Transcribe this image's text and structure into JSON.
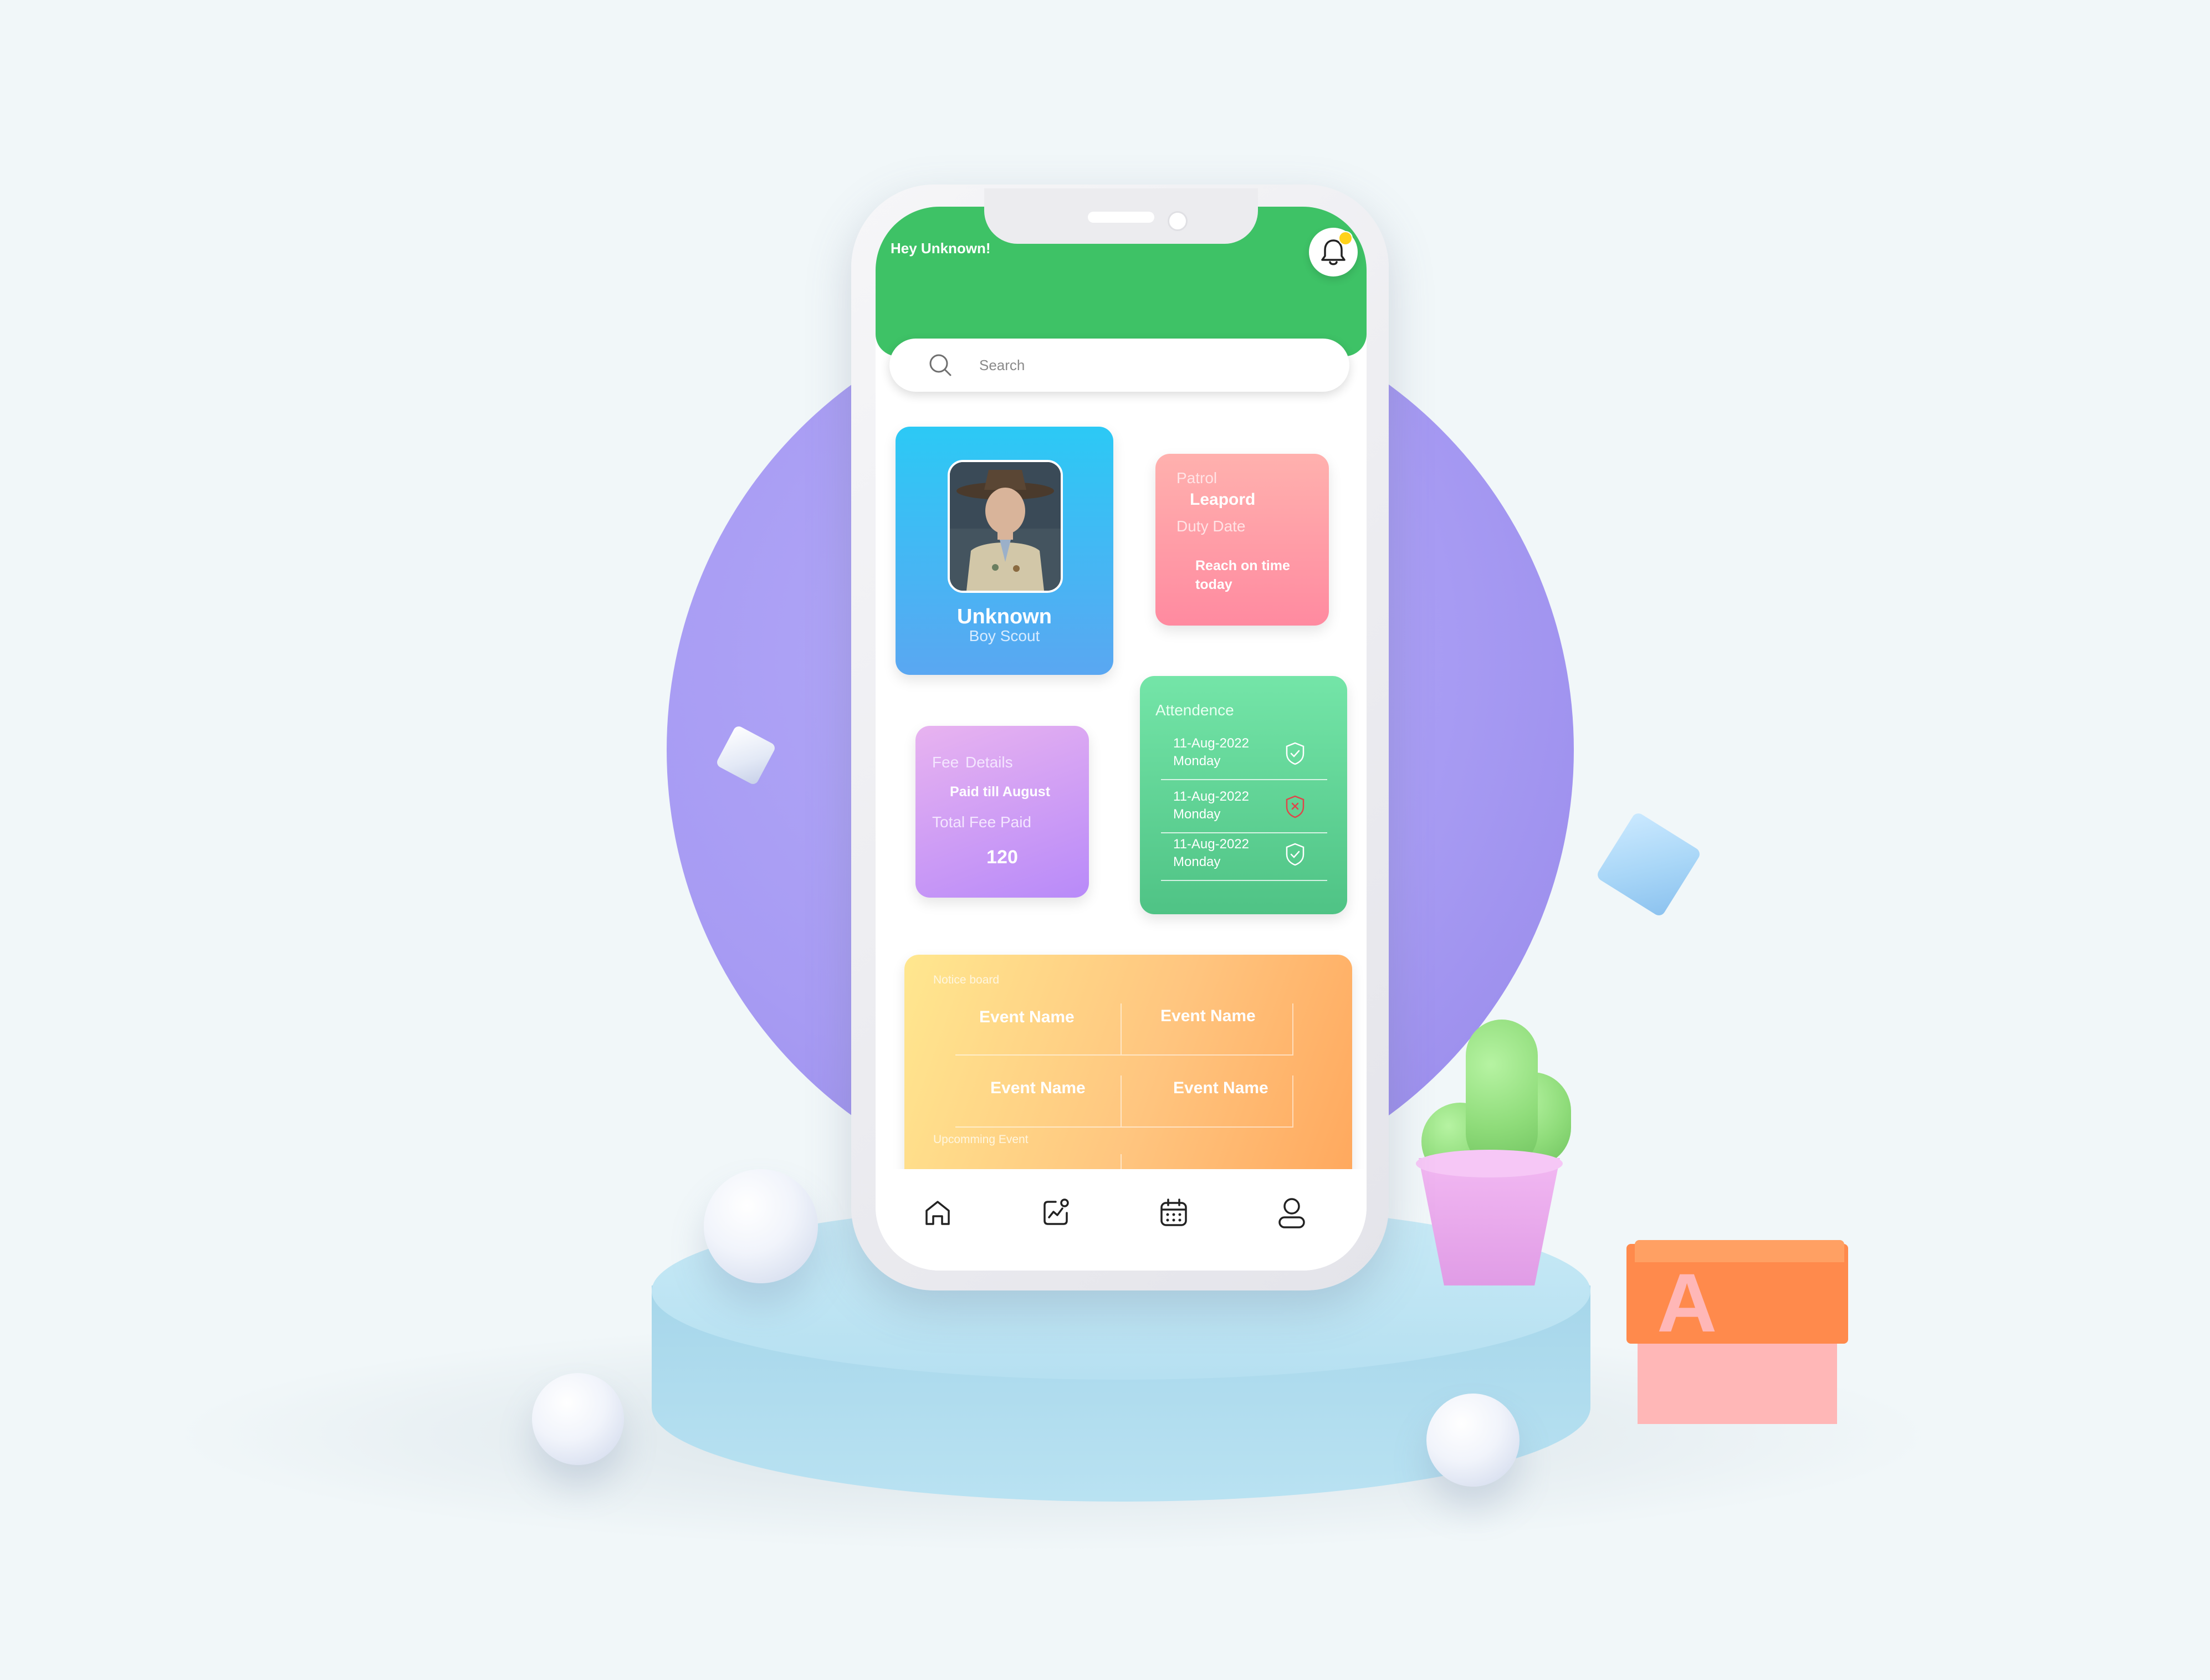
{
  "header": {
    "greeting": "Hey Unknown!"
  },
  "search": {
    "placeholder": "Search"
  },
  "profile": {
    "name": "Unknown",
    "role": "Boy Scout"
  },
  "patrol_card": {
    "patrol_label": "Patrol",
    "patrol_value": "Leapord",
    "duty_label": "Duty Date",
    "duty_value_line1": "Reach on time",
    "duty_value_line2": "today"
  },
  "fee_card": {
    "title_1": "Fee",
    "title_2": "Details",
    "status": "Paid till August",
    "total_label": "Total Fee Paid",
    "total_value": "120"
  },
  "attendance": {
    "title": "Attendence",
    "rows": [
      {
        "date": "11-Aug-2022",
        "day": "Monday",
        "status": "present"
      },
      {
        "date": "11-Aug-2022",
        "day": "Monday",
        "status": "absent"
      },
      {
        "date": "11-Aug-2022",
        "day": "Monday",
        "status": "present"
      }
    ]
  },
  "notice_board": {
    "title": "Notice board",
    "events": [
      "Event Name",
      "Event Name",
      "Event Name",
      "Event Name"
    ],
    "upcoming_label": "Upcomming Event"
  },
  "tabbar": {
    "items": [
      "home-icon",
      "analytics-icon",
      "calendar-icon",
      "profile-icon"
    ]
  },
  "decor": {
    "block_letter": "A"
  },
  "colors": {
    "header_green": "#3ec266",
    "profile_gradient": [
      "#2cc9f5",
      "#5aa7f2"
    ],
    "patrol_gradient": [
      "#ffb1ae",
      "#ff8aa0"
    ],
    "fee_gradient": [
      "#e8b3f0",
      "#b88af9"
    ],
    "attendance_gradient": [
      "#74e5a8",
      "#4fc385"
    ],
    "notice_gradient": [
      "#ffe78f",
      "#ffa85d"
    ],
    "absent_red": "#e0454a"
  }
}
